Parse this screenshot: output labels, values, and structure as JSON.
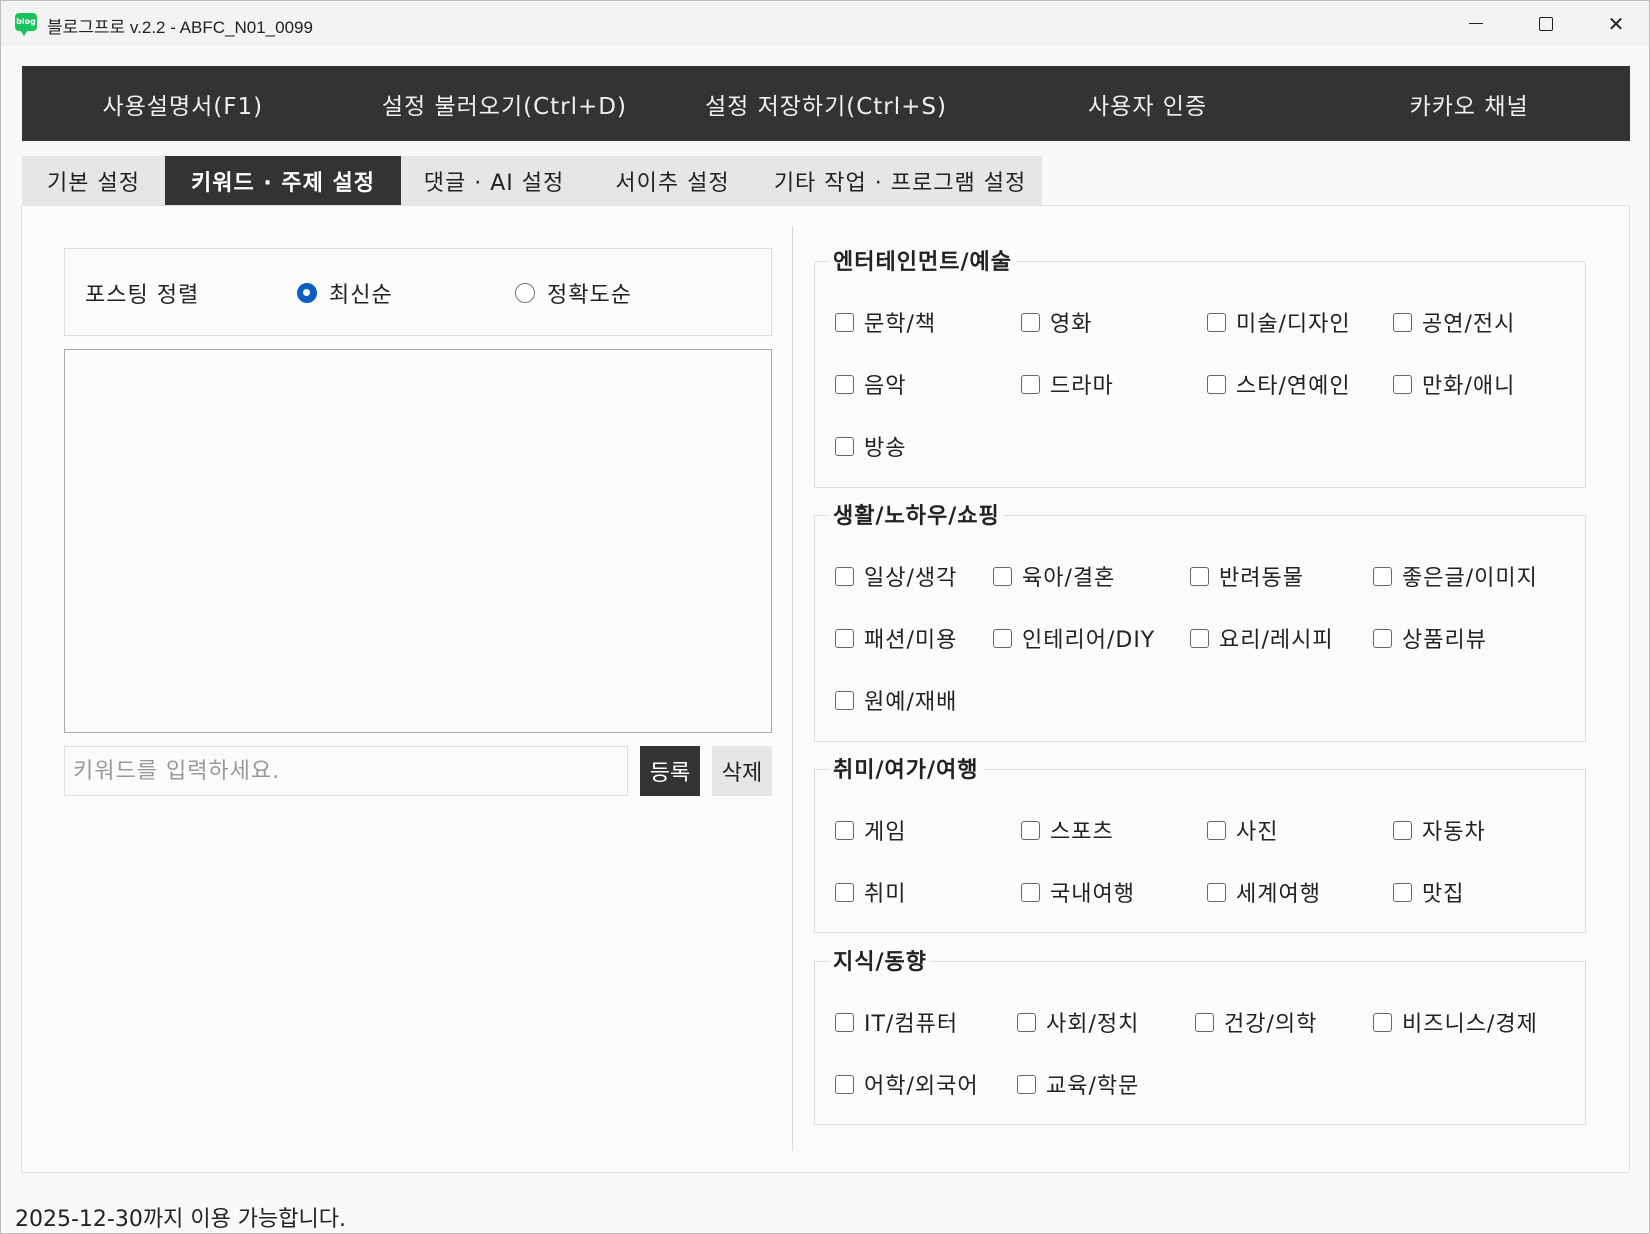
{
  "window": {
    "title": "블로그프로 v.2.2 - ABFC_N01_0099",
    "app_icon_text": "blog"
  },
  "menu": [
    "사용설명서(F1)",
    "설정 불러오기(Ctrl+D)",
    "설정 저장하기(Ctrl+S)",
    "사용자 인증",
    "카카오 채널"
  ],
  "tabs": [
    {
      "label": "기본 설정",
      "active": false
    },
    {
      "label": "키워드 · 주제 설정",
      "active": true
    },
    {
      "label": "댓글 · AI 설정",
      "active": false
    },
    {
      "label": "서이추 설정",
      "active": false
    },
    {
      "label": "기타 작업 · 프로그램 설정",
      "active": false
    }
  ],
  "sort": {
    "label": "포스팅 정렬",
    "options": [
      {
        "label": "최신순",
        "checked": true
      },
      {
        "label": "정확도순",
        "checked": false
      }
    ]
  },
  "keyword": {
    "placeholder": "키워드를 입력하세요.",
    "register_label": "등록",
    "delete_label": "삭제"
  },
  "groups": [
    {
      "title": "엔터테인먼트/예술",
      "items": [
        "문학/책",
        "영화",
        "미술/디자인",
        "공연/전시",
        "음악",
        "드라마",
        "스타/연예인",
        "만화/애니",
        "방송"
      ]
    },
    {
      "title": "생활/노하우/쇼핑",
      "items": [
        "일상/생각",
        "육아/결혼",
        "반려동물",
        "좋은글/이미지",
        "패션/미용",
        "인테리어/DIY",
        "요리/레시피",
        "상품리뷰",
        "원예/재배"
      ]
    },
    {
      "title": "취미/여가/여행",
      "items": [
        "게임",
        "스포츠",
        "사진",
        "자동차",
        "취미",
        "국내여행",
        "세계여행",
        "맛집"
      ]
    },
    {
      "title": "지식/동향",
      "items": [
        "IT/컴퓨터",
        "사회/정치",
        "건강/의학",
        "비즈니스/경제",
        "어학/외국어",
        "교육/학문"
      ]
    }
  ],
  "footer": {
    "license_text": "2025-12-30까지 이용 가능합니다."
  },
  "colors": {
    "dark": "#333333",
    "accent": "#0a5fc0"
  }
}
